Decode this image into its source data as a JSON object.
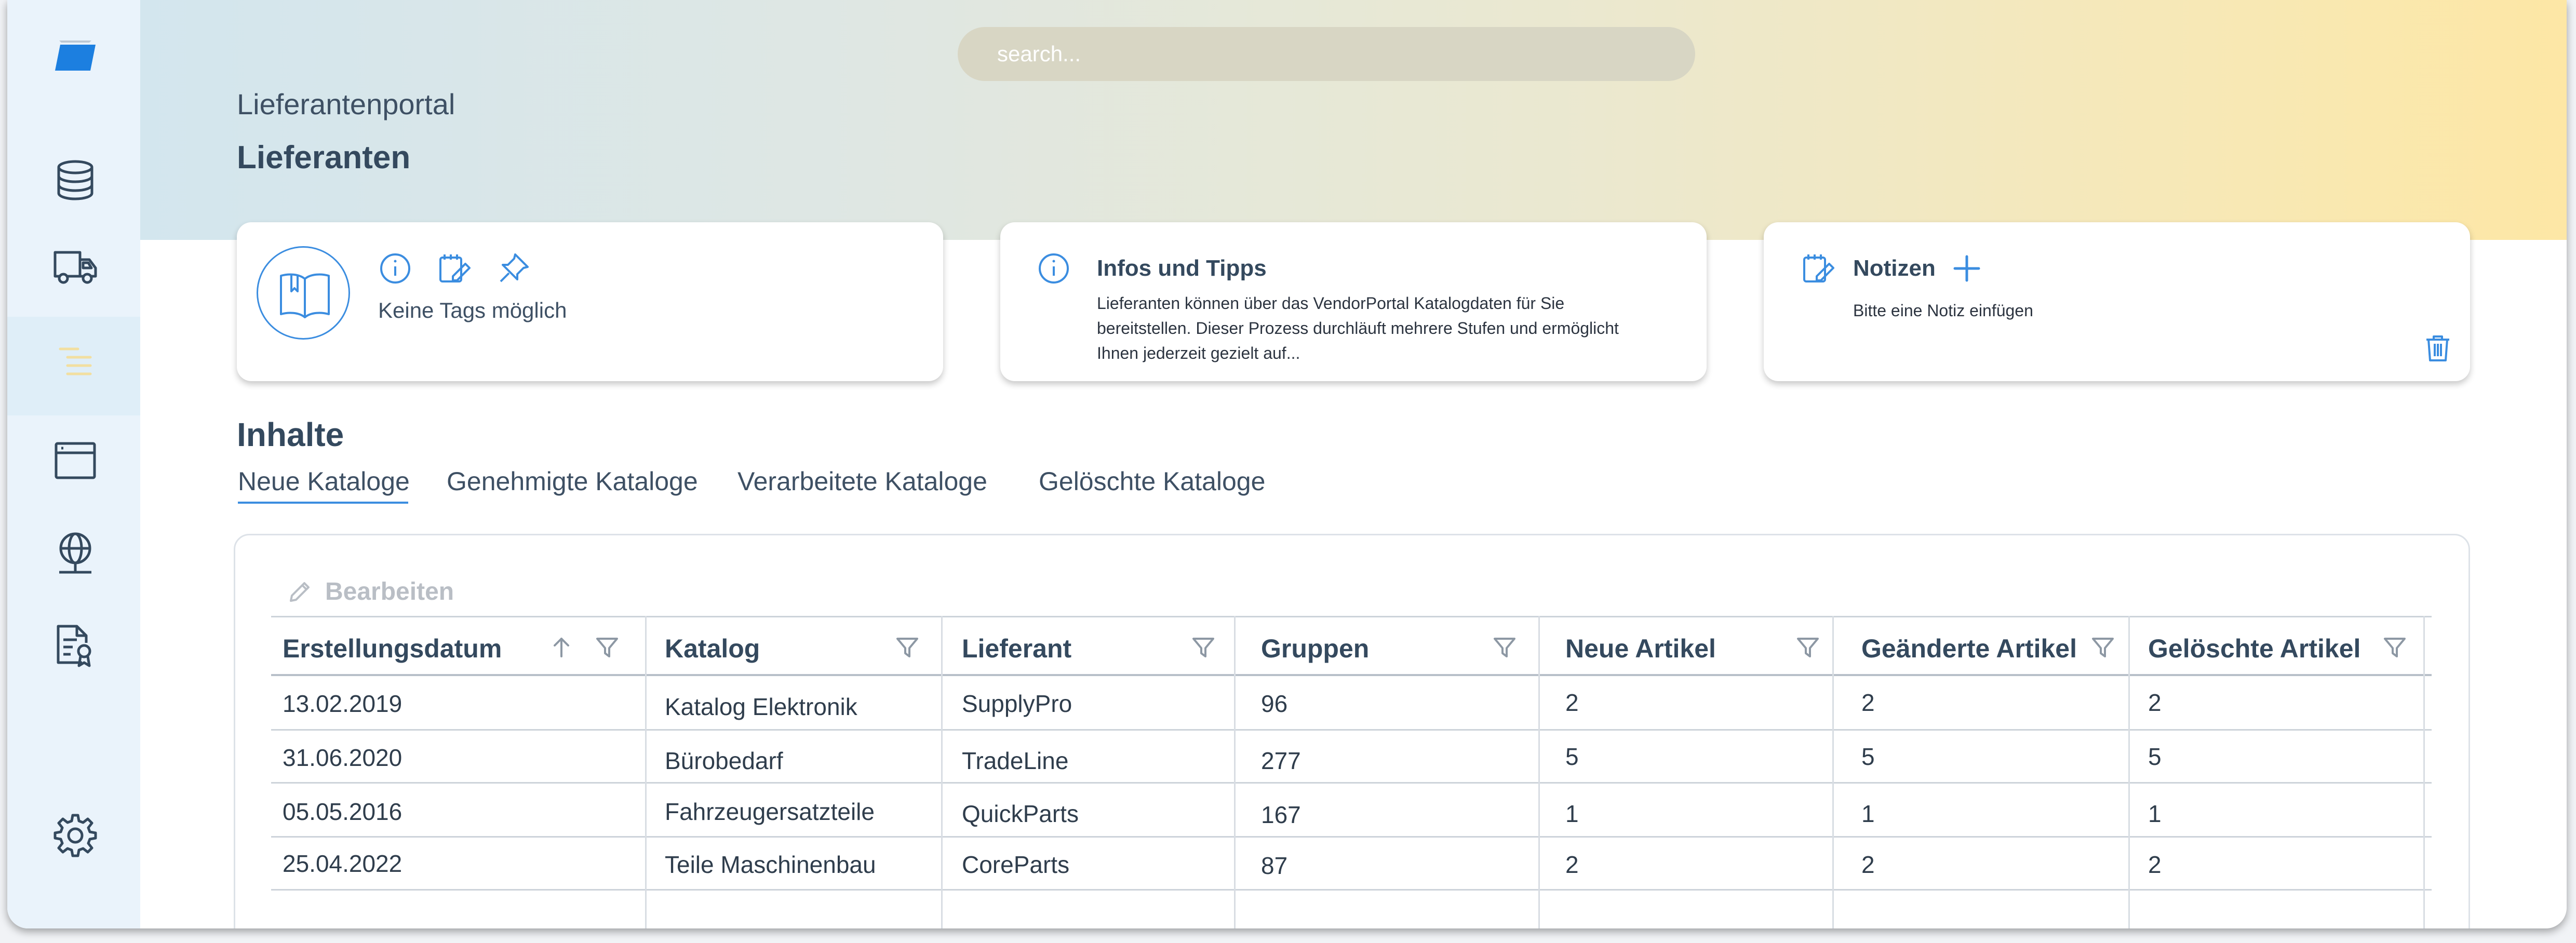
{
  "app": {
    "breadcrumb": "Lieferantenportal",
    "title": "Lieferanten"
  },
  "search": {
    "placeholder": "search..."
  },
  "colors": {
    "accent": "#3b8de0",
    "heading": "#34495e",
    "sidebar": "#eaf3fb"
  },
  "sidebar": {
    "items": [
      {
        "icon": "logo-icon"
      },
      {
        "icon": "database-icon"
      },
      {
        "icon": "truck-icon"
      },
      {
        "icon": "list-icon",
        "active": true
      },
      {
        "icon": "browser-window-icon"
      },
      {
        "icon": "globe-icon"
      },
      {
        "icon": "certificate-icon"
      },
      {
        "icon": "gear-icon"
      }
    ]
  },
  "cards": {
    "tags": {
      "text": "Keine Tags möglich"
    },
    "info": {
      "title": "Infos und Tipps",
      "lines": [
        "Lieferanten können über das VendorPortal Katalogdaten für Sie",
        "bereitstellen. Dieser Prozess durchläuft mehrere Stufen und ermöglicht",
        "Ihnen jederzeit gezielt auf..."
      ]
    },
    "notes": {
      "title": "Notizen",
      "text": "Bitte eine Notiz einfügen"
    }
  },
  "content": {
    "title": "Inhalte",
    "tabs": [
      {
        "label": "Neue Kataloge",
        "active": true
      },
      {
        "label": "Genehmigte Kataloge"
      },
      {
        "label": "Verarbeitete Kataloge"
      },
      {
        "label": "Gelöschte Kataloge"
      }
    ],
    "edit_label": "Bearbeiten"
  },
  "table": {
    "columns": [
      "Erstellungsdatum",
      "Katalog",
      "Lieferant",
      "Gruppen",
      "Neue Artikel",
      "Geänderte Artikel",
      "Gelöschte Artikel"
    ],
    "rows": [
      [
        "13.02.2019",
        "Katalog Elektronik",
        "SupplyPro",
        "96",
        "2",
        "2",
        "2"
      ],
      [
        "31.06.2020",
        "Bürobedarf",
        "TradeLine",
        "277",
        "5",
        "5",
        "5"
      ],
      [
        "05.05.2016",
        "Fahrzeugersatzteile",
        "QuickParts",
        "167",
        "1",
        "1",
        "1"
      ],
      [
        "25.04.2022",
        "Teile Maschinenbau",
        "CoreParts",
        "87",
        "2",
        "2",
        "2"
      ]
    ]
  }
}
